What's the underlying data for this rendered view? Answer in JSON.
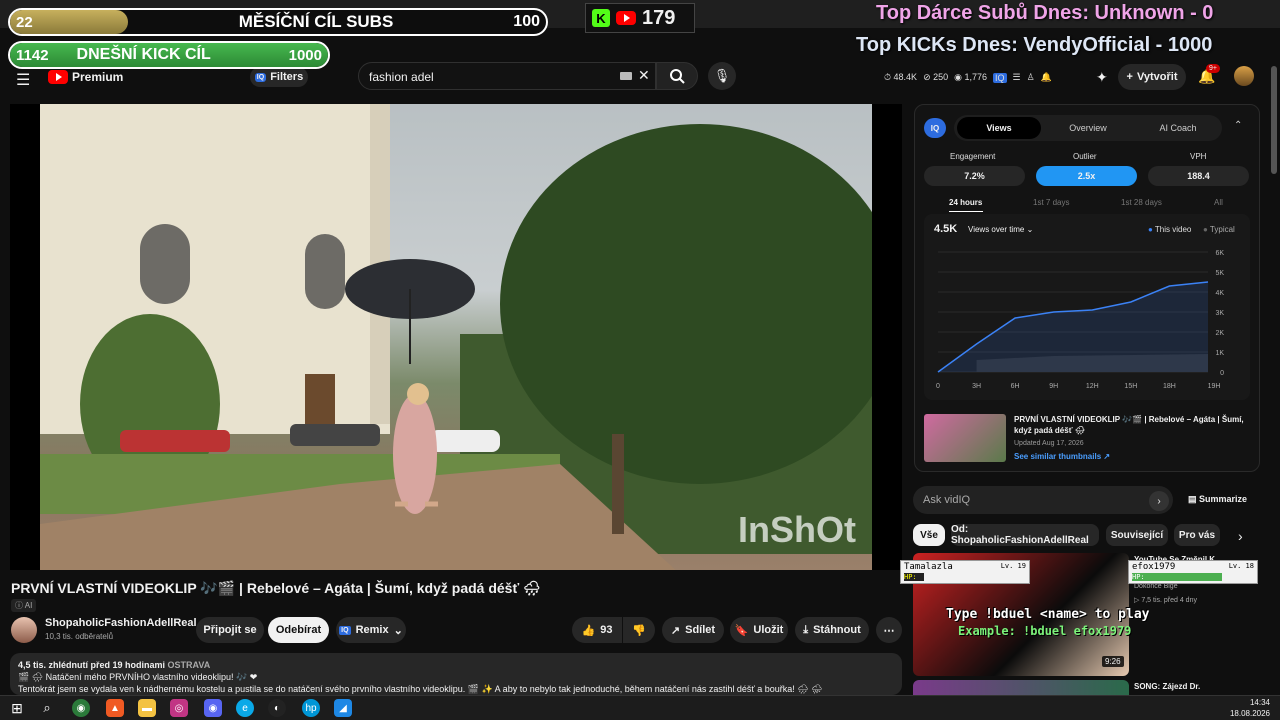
{
  "overlay": {
    "subs_goal": {
      "current": "22",
      "label": "MĚSÍČNÍ CÍL SUBS",
      "target": "100"
    },
    "kick_goal": {
      "current": "1142",
      "label": "DNEŠNÍ KICK CÍL",
      "target": "1000"
    },
    "kick_viewers": "179",
    "top_donors": "Top Dárce Subů Dnes: Unknown - 0",
    "top_kicks": "Top KICKs Dnes: VendyOfficial - 1000"
  },
  "header": {
    "logo": "Premium",
    "filters": "Filters",
    "search_value": "fashion adel",
    "stats": {
      "views": "48.4K",
      "likes": "250",
      "watching": "1,776"
    },
    "create": "Vytvořit",
    "notif_count": "9+"
  },
  "video": {
    "watermark": "InShOt",
    "title": "PRVNÍ VLASTNÍ VIDEOKLIP 🎶🎬 | Rebelové – Agáta | Šumí, když padá déšť 🌧",
    "ai_label": "AI",
    "channel": "ShopaholicFashionAdellReal",
    "subs": "10,3 tis. odběratelů",
    "join": "Připojit se",
    "subscribe": "Odebírat",
    "remix": "Remix",
    "likes": "93",
    "share": "Sdílet",
    "save": "Uložit",
    "download": "Stáhnout",
    "meta": "4,5 tis. zhlédnutí  před 19 hodinami",
    "location": "OSTRAVA",
    "desc1": "🎬 🌧 Natáčení mého PRVNÍHO vlastního videoklipu! 🎶 ❤",
    "desc2": "Tentokrát jsem se vydala ven k nádhernému kostelu a pustila se do natáčení svého prvního vlastního videoklipu. 🎬 ✨ A aby to nebylo tak jednoduché, během natáčení nás zastihl déšť a bouřka! 🌧 ⛈"
  },
  "vidiq": {
    "tabs": [
      "Views",
      "Overview",
      "AI Coach"
    ],
    "metrics": [
      {
        "label": "Engagement",
        "value": "7.2%"
      },
      {
        "label": "Outlier",
        "value": "2.5x"
      },
      {
        "label": "VPH",
        "value": "188.4"
      }
    ],
    "ranges": [
      "24 hours",
      "1st 7 days",
      "1st 28 days",
      "All"
    ],
    "chart_views": "4.5K",
    "chart_mode": "Views over time",
    "legend_this": "This video",
    "legend_typical": "Typical",
    "thumb_title": "PRVNÍ VLASTNÍ VIDEOKLIP 🎶🎬 | Rebelové – Agáta | Šumí, když padá déšť 🌧",
    "thumb_updated": "Updated Aug 17, 2026",
    "thumb_link": "See similar thumbnails ↗",
    "ask": "Ask vidIQ",
    "summarize": "Summarize"
  },
  "chart_data": {
    "type": "line",
    "x": [
      "0",
      "3H",
      "6H",
      "9H",
      "12H",
      "15H",
      "18H",
      "19H"
    ],
    "series": [
      {
        "name": "This video",
        "values": [
          0,
          1400,
          2700,
          3000,
          3100,
          3500,
          4300,
          4500
        ]
      }
    ],
    "yticks": [
      "0",
      "1K",
      "2K",
      "3K",
      "4K",
      "5K",
      "6K"
    ],
    "ylim": [
      0,
      6000
    ]
  },
  "chips": [
    "Vše",
    "Od: ShopaholicFashionAdellReal",
    "Související",
    "Pro vás"
  ],
  "recs": [
    {
      "title": "YouTube Se Změnil K...",
      "meta1": "Dokonce Bigé",
      "meta2": "▷ 7,5 tis.  před 4 dny",
      "duration": "9:26"
    },
    {
      "title": "SONG: Zájezd Dr."
    }
  ],
  "game": {
    "p1": "Tamalazla",
    "p1lv": "Lv. 19",
    "p2": "efox1979",
    "p2lv": "Lv. 18",
    "hp": "HP:",
    "line1": "Type !bduel <name> to play",
    "line2": "Example: !bduel efox1979"
  },
  "taskbar": {
    "time": "14:34",
    "date": "18.08.2026"
  }
}
